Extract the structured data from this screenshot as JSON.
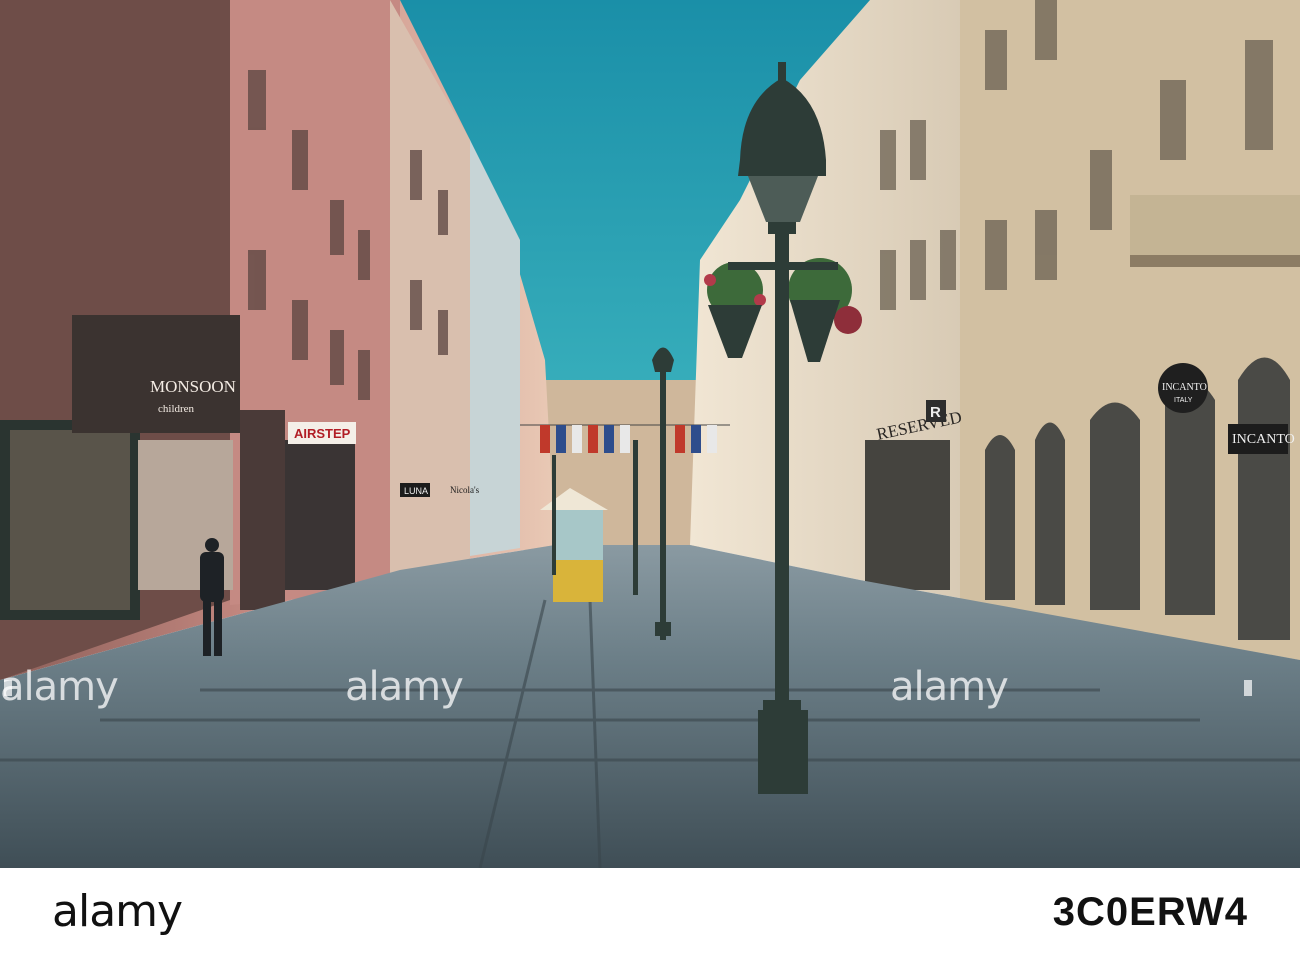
{
  "scene": {
    "description_free": true
  },
  "signs": {
    "monsoon": "MONSOON",
    "monsoon_sub": "children",
    "airstep": "AIRSTEP",
    "luna": "LUNA",
    "nicola": "Nicola's",
    "reserved": "RESERVED",
    "reserved_mark": "R",
    "incanto_small": "INCANTO",
    "incanto_small_sub": "ITALY",
    "incanto_large": "INCANTO"
  },
  "watermark": {
    "text": "alamy"
  },
  "footer": {
    "logo": "alamy",
    "image_id": "3C0ERW4"
  },
  "colors": {
    "sky": "#1f9fb0",
    "pavement": "#5d6f78",
    "lamp": "#2d3c37"
  }
}
